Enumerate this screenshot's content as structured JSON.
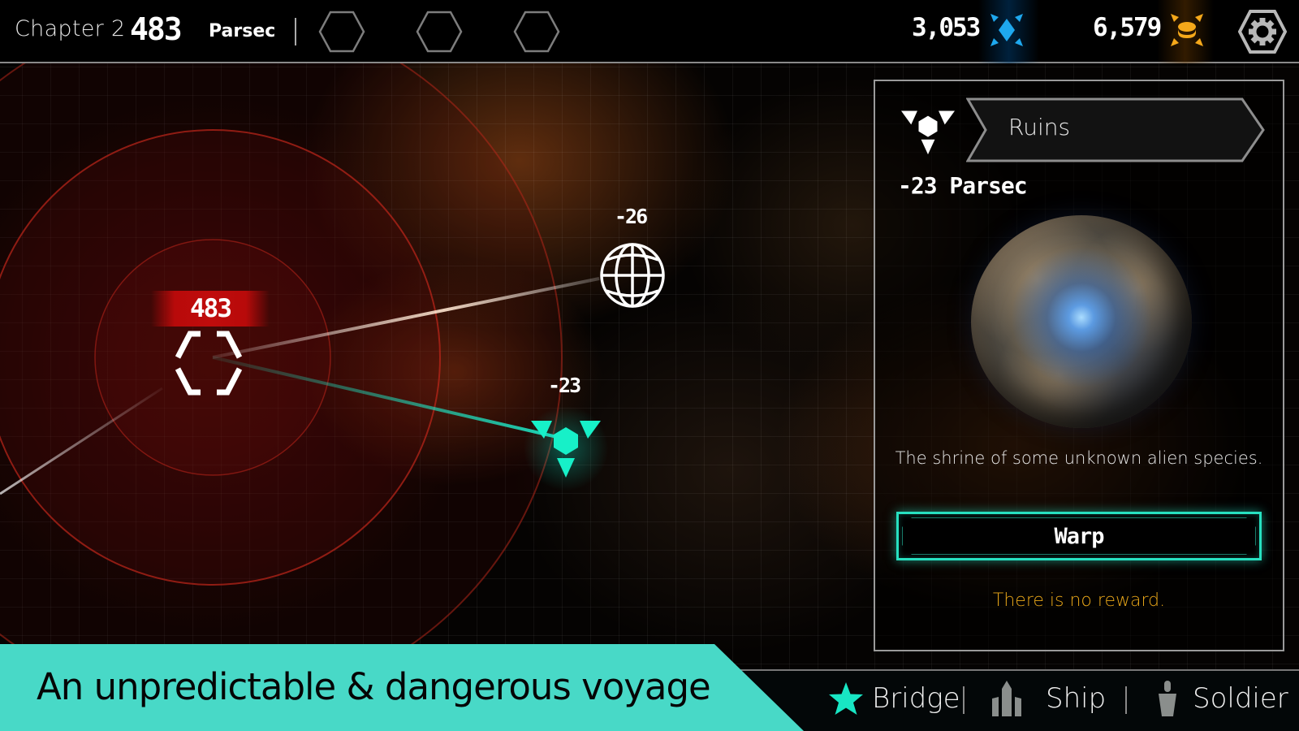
{
  "topbar": {
    "chapter_label": "Chapter 2",
    "parsec_value": "483",
    "parsec_unit": "Parsec",
    "slots": [
      {
        "icon": "empty-hexagon-slot"
      },
      {
        "icon": "empty-hexagon-slot"
      },
      {
        "icon": "empty-hexagon-slot"
      }
    ],
    "currencies": [
      {
        "name": "crystal",
        "value": "3,053",
        "icon": "blue-crystal-icon",
        "color": "#1ea8ee"
      },
      {
        "name": "gold",
        "value": "6,579",
        "icon": "gold-coin-icon",
        "color": "#f5a81a"
      }
    ],
    "settings_icon": "gear-icon"
  },
  "map": {
    "base_node": {
      "label": "483",
      "icon": "hexagon-base-icon",
      "label_color": "#c00c0c"
    },
    "planet_node": {
      "label": "-26",
      "icon": "globe-icon"
    },
    "ruins_node": {
      "label": "-23",
      "icon": "ruins-tri-icon",
      "color": "#17f0c8",
      "selected": true
    }
  },
  "panel": {
    "type_icon": "ruins-tri-icon",
    "name": "Ruins",
    "distance": "-23 Parsec",
    "description": "The shrine of some unknown alien species.",
    "warp_label": "Warp",
    "reward_text": "There is no reward.",
    "accent_color": "#27e0c0",
    "reward_color": "#e8a619"
  },
  "tagline": {
    "text": "An unpredictable & dangerous voyage",
    "background": "#48d9c7"
  },
  "bottom_nav": {
    "items": [
      {
        "label": "Bridge",
        "icon": "star-icon",
        "active": true,
        "icon_color": "#18e6c4"
      },
      {
        "label": "Ship",
        "icon": "ship-icon",
        "active": false,
        "icon_color": "#8a8e8c"
      },
      {
        "label": "Soldier",
        "icon": "soldier-icon",
        "active": false,
        "icon_color": "#8a8e8c"
      }
    ]
  }
}
